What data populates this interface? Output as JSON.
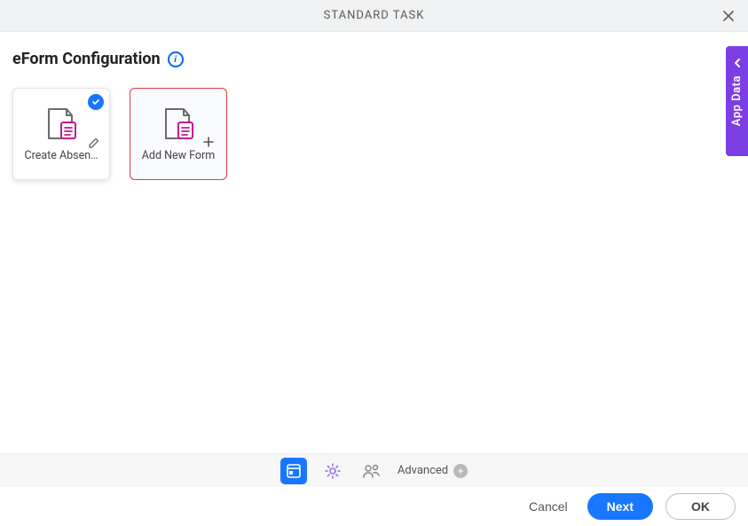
{
  "header": {
    "title": "STANDARD TASK"
  },
  "section": {
    "title": "eForm Configuration"
  },
  "cards": {
    "selected": {
      "label": "Create Absen…"
    },
    "add": {
      "label": "Add New Form"
    }
  },
  "sidebar": {
    "app_data": "App Data"
  },
  "toolbar": {
    "advanced_label": "Advanced"
  },
  "footer": {
    "cancel": "Cancel",
    "next": "Next",
    "ok": "OK"
  }
}
